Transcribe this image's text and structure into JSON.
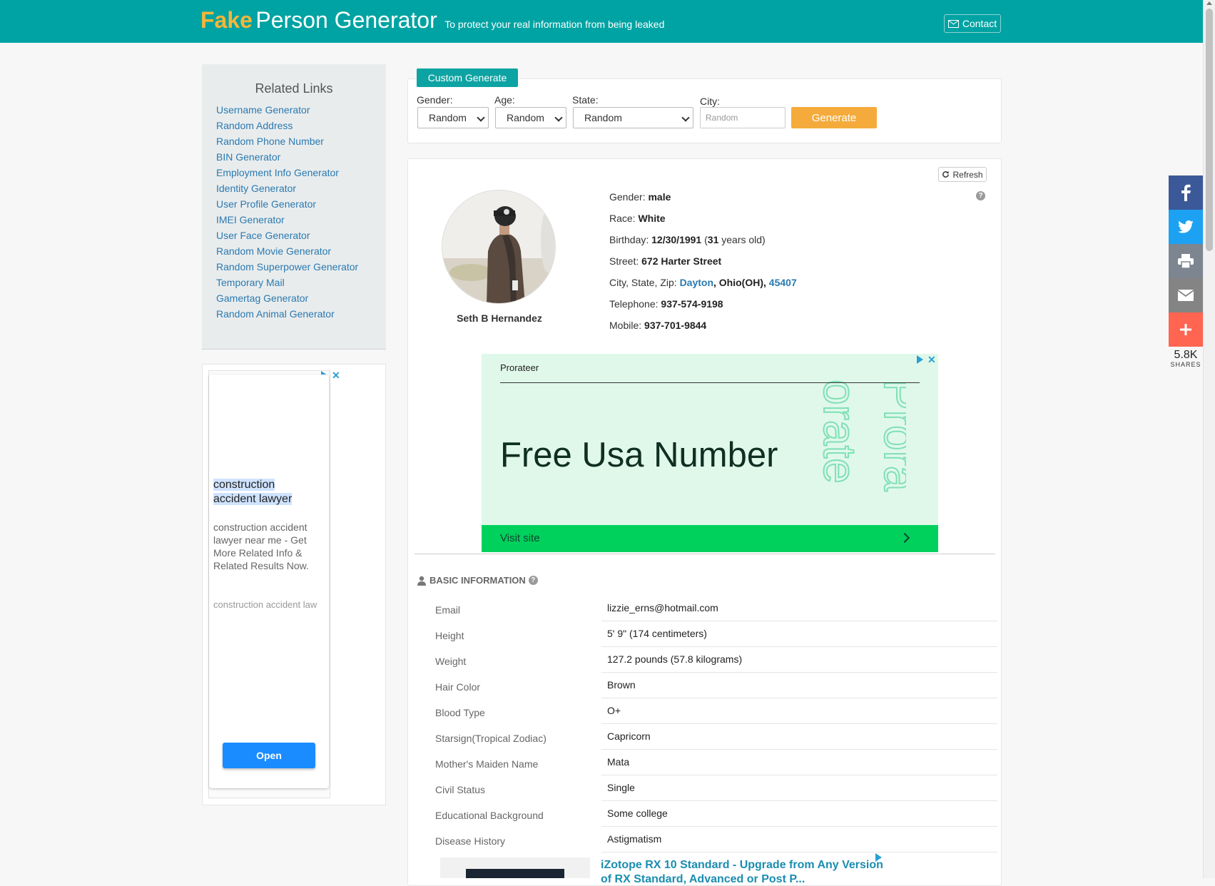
{
  "header": {
    "brand_fake": "Fake",
    "brand_rest": "Person Generator",
    "tagline": "To protect your real information from being leaked",
    "contact_label": "Contact"
  },
  "sidebar": {
    "title": "Related Links",
    "links": [
      "Username Generator",
      "Random Address",
      "Random Phone Number",
      "BIN Generator",
      "Employment Info Generator",
      "Identity Generator",
      "User Profile Generator",
      "IMEI Generator",
      "User Face Generator",
      "Random Movie Generator",
      "Random Superpower Generator",
      "Temporary Mail",
      "Gamertag Generator",
      "Random Animal Generator"
    ]
  },
  "side_ad": {
    "headline_1": "construction",
    "headline_2": "accident lawyer",
    "body": "construction accident lawyer near me - Get More Related Info & Related Results Now.",
    "url": "construction accident law",
    "button": "Open"
  },
  "custom": {
    "tab_label": "Custom Generate",
    "gender_label": "Gender:",
    "gender_value": "Random",
    "age_label": "Age:",
    "age_value": "Random",
    "state_label": "State:",
    "state_value": "Random",
    "city_label": "City:",
    "city_placeholder": "Random",
    "generate_label": "Generate"
  },
  "profile": {
    "refresh_label": "Refresh",
    "name": "Seth B Hernandez",
    "gender_label": "Gender:",
    "gender": "male",
    "race_label": "Race:",
    "race": "White",
    "birthday_label": "Birthday:",
    "birthday": "12/30/1991",
    "age_open": "(",
    "age_years": "31",
    "age_suffix": "years old)",
    "street_label": "Street:",
    "street": "672 Harter Street",
    "csz_label": "City, State, Zip:",
    "city": "Dayton",
    "state": ", Ohio(OH),",
    "zip": "45407",
    "telephone_label": "Telephone:",
    "telephone": "937-574-9198",
    "mobile_label": "Mobile:",
    "mobile": "937-701-9844"
  },
  "center_ad": {
    "brand": "Prorateer",
    "headline": "Free Usa Number",
    "cta": "Visit site"
  },
  "basic": {
    "title": "BASIC INFORMATION",
    "rows": [
      {
        "key": "Email",
        "value": "lizzie_erns@hotmail.com"
      },
      {
        "key": "Height",
        "value": "5' 9\" (174 centimeters)"
      },
      {
        "key": "Weight",
        "value": "127.2 pounds (57.8 kilograms)"
      },
      {
        "key": "Hair Color",
        "value": "Brown"
      },
      {
        "key": "Blood Type",
        "value": "O+"
      },
      {
        "key": "Starsign(Tropical Zodiac)",
        "value": "Capricorn"
      },
      {
        "key": "Mother's Maiden Name",
        "value": "Mata"
      },
      {
        "key": "Civil Status",
        "value": "Single"
      },
      {
        "key": "Educational Background",
        "value": "Some college"
      },
      {
        "key": "Disease History",
        "value": "Astigmatism"
      }
    ]
  },
  "bottom_ad": {
    "title": "iZotope RX 10 Standard - Upgrade from Any Version",
    "subtitle": "of RX Standard, Advanced or Post P..."
  },
  "social": {
    "count": "5.8K",
    "label": "SHARES",
    "icons": [
      "facebook-icon",
      "twitter-icon",
      "print-icon",
      "email-icon",
      "plus-icon"
    ],
    "colors": {
      "facebook": "#3b5998",
      "twitter": "#1da1f2",
      "print": "#7d8590",
      "email": "#848484",
      "plus": "#ff6550"
    }
  },
  "colors": {
    "header_bg": "#00a3a3",
    "brand_accent": "#f5b639",
    "generate_button": "#f5ab3b",
    "link": "#2a7ab0"
  }
}
